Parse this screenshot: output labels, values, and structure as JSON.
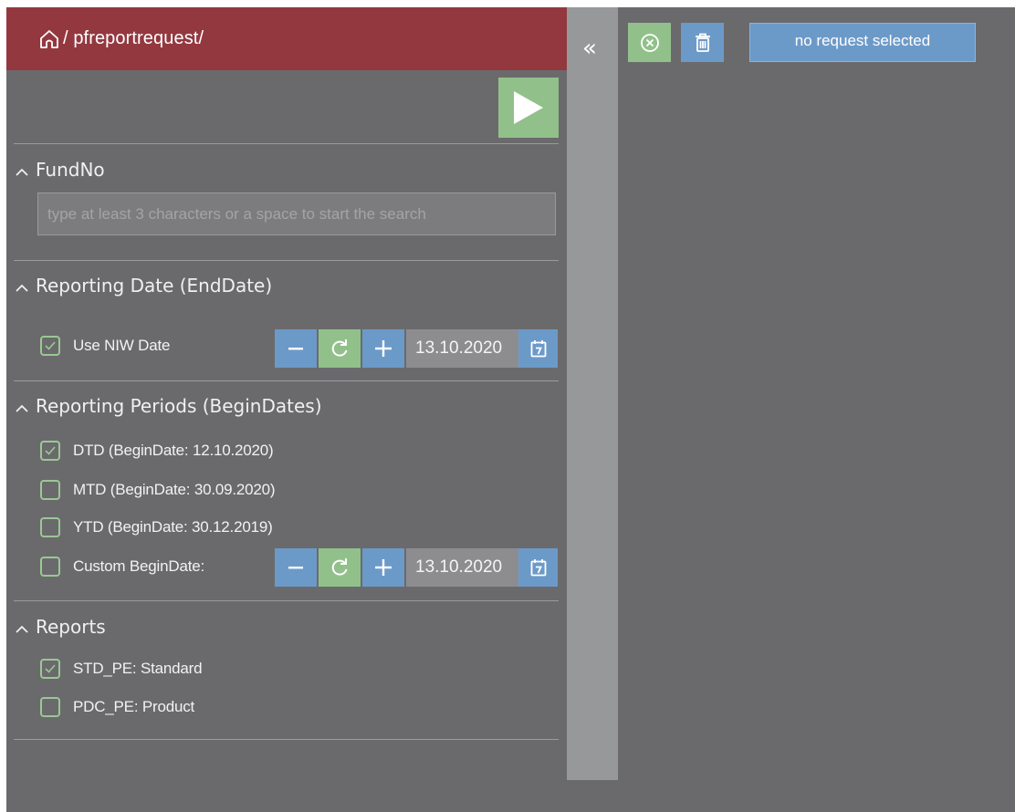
{
  "header": {
    "path": "/ pfreportrequest/",
    "icon": "home-icon"
  },
  "run_button": {
    "icon": "play-icon"
  },
  "sections": {
    "fundno": {
      "title": "FundNo",
      "placeholder": "type at least 3 characters or a space to start the search",
      "value": ""
    },
    "reporting_date": {
      "title": "Reporting Date (EndDate)",
      "use_nav": {
        "label": "Use NIW Date",
        "checked": true
      },
      "date": "13.10.2020"
    },
    "reporting_periods": {
      "title": "Reporting Periods (BeginDates)",
      "items": [
        {
          "label": "DTD (BeginDate: 12.10.2020)",
          "checked": true
        },
        {
          "label": "MTD (BeginDate: 30.09.2020)",
          "checked": false
        },
        {
          "label": "YTD (BeginDate: 30.12.2019)",
          "checked": false
        },
        {
          "label": "Custom BeginDate:",
          "checked": false
        }
      ],
      "custom_date": "13.10.2020"
    },
    "reports": {
      "title": "Reports",
      "items": [
        {
          "label": "STD_PE: Standard",
          "checked": true
        },
        {
          "label": "PDC_PE: Product",
          "checked": false
        }
      ]
    }
  },
  "collapse": {
    "label": "«"
  },
  "toolbar": {
    "status_label": "no request selected"
  },
  "colors": {
    "header": "#943840",
    "green": "#92c08a",
    "blue": "#6c9ac8",
    "panel": "#6a6a6c"
  }
}
